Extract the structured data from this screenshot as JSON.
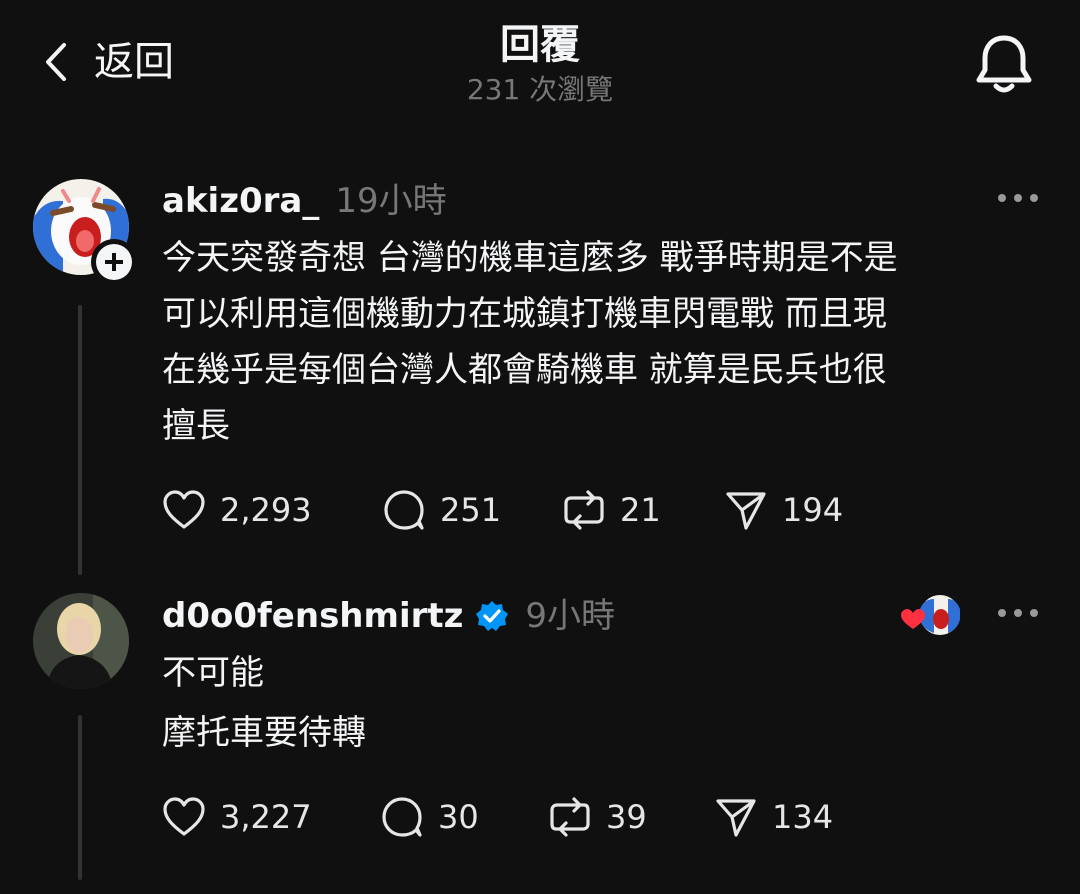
{
  "header": {
    "back_label": "返回",
    "title": "回覆",
    "subtitle": "231 次瀏覽",
    "icons": [
      "chevron-left-icon",
      "bell-icon"
    ]
  },
  "posts": [
    {
      "username": "akiz0ra_",
      "time": "19小時",
      "lines": [
        "今天突發奇想 台灣的機車這麼多 戰爭時期是不是",
        "可以利用這個機動力在城鎮打機車閃電戰 而且現",
        "在幾乎是每個台灣人都會騎機車 就算是民兵也很",
        "擅長"
      ],
      "likes": "2,293",
      "comments": "251",
      "reposts": "21",
      "shares": "194"
    },
    {
      "username": "d0o0fenshmirtz",
      "verified": true,
      "time": "9小時",
      "lines": [
        "不可能",
        "摩托車要待轉"
      ],
      "likes": "3,227",
      "comments": "30",
      "reposts": "39",
      "shares": "134"
    }
  ],
  "colors": {
    "background": "#101010",
    "text": "#f3f5f7",
    "muted": "#777777",
    "verified": "#0095f6",
    "heart": "#ff3040"
  }
}
